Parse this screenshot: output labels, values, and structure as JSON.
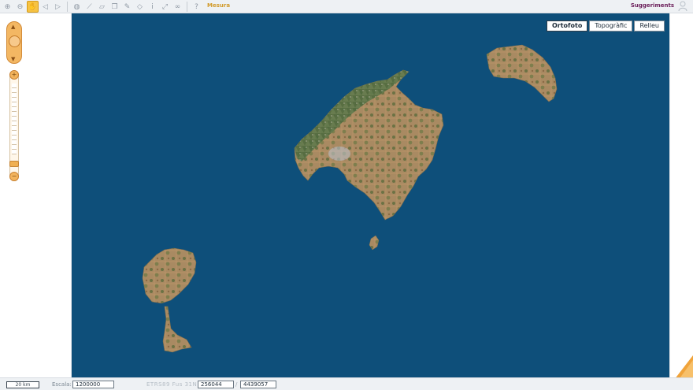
{
  "toolbar": {
    "tools": [
      {
        "name": "zoom-in-tool-icon",
        "glyph": "⊕",
        "active": false
      },
      {
        "name": "zoom-out-tool-icon",
        "glyph": "⊖",
        "active": false
      },
      {
        "name": "pan-hand-tool-icon",
        "glyph": "✋",
        "active": true
      },
      {
        "name": "zoom-previous-icon",
        "glyph": "◁",
        "active": false
      },
      {
        "name": "zoom-next-icon",
        "glyph": "▷",
        "active": false
      },
      {
        "name": "globe-icon",
        "glyph": "◍",
        "active": false
      },
      {
        "name": "measure-line-icon",
        "glyph": "⟋",
        "active": false
      },
      {
        "name": "measure-area-icon",
        "glyph": "▱",
        "active": false
      },
      {
        "name": "copy-icon",
        "glyph": "❐",
        "active": false
      },
      {
        "name": "pencil-icon",
        "glyph": "✎",
        "active": false
      },
      {
        "name": "eraser-icon",
        "glyph": "◇",
        "active": false
      },
      {
        "name": "info-icon",
        "glyph": "i",
        "active": false
      },
      {
        "name": "full-extent-icon",
        "glyph": "⤢",
        "active": false
      },
      {
        "name": "link-icon",
        "glyph": "∞",
        "active": false
      },
      {
        "name": "help-icon",
        "glyph": "?",
        "active": false
      }
    ],
    "measure_label": "Mesura",
    "suggest_label": "Suggeriments"
  },
  "layers": {
    "ortofoto": "Ortofoto",
    "topografic": "Topogràfic",
    "relleu": "Relleu",
    "active": "Ortofoto"
  },
  "status": {
    "scale_bar_label": "20 km",
    "scale_label": "Escala:",
    "scale_value": "1200000",
    "coord_label": "ETRS89 Fus 31N",
    "x_value": "256044",
    "y_value": "4439057"
  },
  "colors": {
    "sea": "#0e4f7a",
    "accent": "#f6c343",
    "suggest": "#6a1d59"
  }
}
